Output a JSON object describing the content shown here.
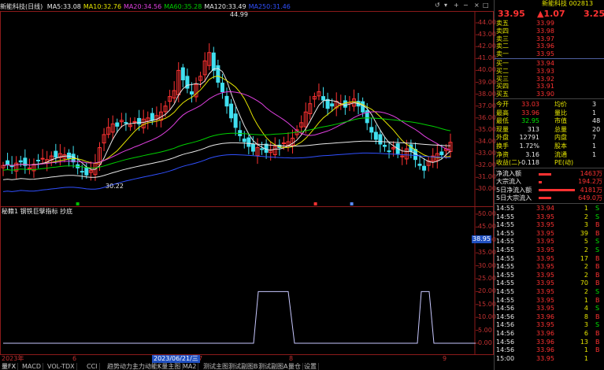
{
  "app": {
    "stock_label": "新能科技(日线)",
    "stock_name": "新能科技",
    "stock_code": "002813"
  },
  "ma_legend": [
    {
      "label": "MA5:",
      "value": "33.08",
      "color": "#e8e8e8"
    },
    {
      "label": "MA10:",
      "value": "32.76",
      "color": "#e6e600"
    },
    {
      "label": "MA20:",
      "value": "34.56",
      "color": "#e040e0"
    },
    {
      "label": "MA60:",
      "value": "35.28",
      "color": "#00d000"
    },
    {
      "label": "MA120:",
      "value": "33.49",
      "color": "#e8e8e8"
    },
    {
      "label": "MA250:",
      "value": "31.46",
      "color": "#3050ff"
    }
  ],
  "top_right": {
    "price": "33.95",
    "change": "▲1.07",
    "change_pct": "3.25"
  },
  "annotations": {
    "high": "44.99",
    "low": "30.22"
  },
  "price_axis": [
    "44.00",
    "43.00",
    "42.00",
    "41.00",
    "40.00",
    "39.00",
    "38.00",
    "37.00",
    "36.00",
    "35.00",
    "34.00",
    "33.00",
    "32.00",
    "31.00",
    "30.00"
  ],
  "indicator": {
    "title": "秘籍1 钢铁巨擘指标 抄底",
    "axis": [
      "50.00",
      "45.00",
      "40.00",
      "35.00",
      "30.00",
      "25.00",
      "20.00",
      "15.00",
      "10.00",
      "5.00",
      "0.00"
    ],
    "current": "38.95",
    "chart_data": {
      "type": "line",
      "x": [
        0,
        1,
        2,
        3,
        4,
        5,
        6,
        7,
        8,
        9,
        10,
        11,
        12,
        13,
        14
      ],
      "y": [
        0,
        0,
        0,
        0,
        0,
        0,
        20,
        20,
        0,
        0,
        0,
        0,
        20,
        0,
        0
      ],
      "ylim": [
        0,
        50
      ]
    }
  },
  "time_axis": {
    "labels": [
      "2023年",
      "6",
      "7",
      "8",
      "9"
    ],
    "highlight": "2023/06/21/三"
  },
  "bottom_tabs": [
    "量FX",
    "MACD",
    "VOL-TDX",
    "CCI",
    "趋势动力",
    "主力动能",
    "K量主图",
    "MA2",
    "测试主图",
    "测试副图B",
    "测试副图A",
    "量仓",
    "设置"
  ],
  "order_book": {
    "sell": [
      {
        "label": "卖五",
        "price": "33.99"
      },
      {
        "label": "卖四",
        "price": "33.98"
      },
      {
        "label": "卖三",
        "price": "33.97"
      },
      {
        "label": "卖二",
        "price": "33.96"
      },
      {
        "label": "卖一",
        "price": "33.95"
      }
    ],
    "buy": [
      {
        "label": "买一",
        "price": "33.94"
      },
      {
        "label": "买二",
        "price": "33.93"
      },
      {
        "label": "买三",
        "price": "33.92"
      },
      {
        "label": "买四",
        "price": "33.91"
      },
      {
        "label": "买五",
        "price": "33.90"
      }
    ]
  },
  "quote": [
    {
      "l1": "今开",
      "v1": "33.03",
      "l2": "均价",
      "v2": "3"
    },
    {
      "l1": "最高",
      "v1": "33.96",
      "l2": "量比",
      "v2": "1"
    },
    {
      "l1": "最低",
      "v1": "32.95",
      "l2": "市值",
      "v2": "48"
    },
    {
      "l1": "现量",
      "v1": "313",
      "l2": "总量",
      "v2": "20"
    },
    {
      "l1": "外盘",
      "v1": "12791",
      "l2": "内盘",
      "v2": "7"
    },
    {
      "l1": "换手",
      "v1": "1.72%",
      "l2": "股本",
      "v2": "1"
    },
    {
      "l1": "净资",
      "v1": "3.16",
      "l2": "流通",
      "v2": "1"
    },
    {
      "l1": "收益(二)",
      "v1": "-0.118",
      "l2": "PE(动)",
      "v2": ""
    }
  ],
  "fund_flow": [
    {
      "label": "净流入额",
      "value": "1463万",
      "bar": 0.3
    },
    {
      "label": "大宗流入",
      "value": "194.2万",
      "bar": 0.08
    },
    {
      "label": "5日净流入额",
      "value": "4181万",
      "bar": 0.85
    },
    {
      "label": "5日大宗流入",
      "value": "649.0万",
      "bar": 0.3
    }
  ],
  "ticks": [
    {
      "time": "14:55",
      "price": "33.94",
      "vol": "1",
      "side": "S"
    },
    {
      "time": "14:55",
      "price": "33.95",
      "vol": "2",
      "side": "S"
    },
    {
      "time": "14:55",
      "price": "33.95",
      "vol": "3",
      "side": "B"
    },
    {
      "time": "14:55",
      "price": "33.95",
      "vol": "39",
      "side": "B"
    },
    {
      "time": "14:55",
      "price": "33.95",
      "vol": "5",
      "side": "S"
    },
    {
      "time": "14:55",
      "price": "33.95",
      "vol": "2",
      "side": "S"
    },
    {
      "time": "14:55",
      "price": "33.95",
      "vol": "17",
      "side": "B"
    },
    {
      "time": "14:55",
      "price": "33.95",
      "vol": "2",
      "side": "B"
    },
    {
      "time": "14:55",
      "price": "33.95",
      "vol": "2",
      "side": "B"
    },
    {
      "time": "14:55",
      "price": "33.95",
      "vol": "70",
      "side": "B"
    },
    {
      "time": "14:55",
      "price": "33.95",
      "vol": "2",
      "side": "S"
    },
    {
      "time": "14:55",
      "price": "33.95",
      "vol": "1",
      "side": "B"
    },
    {
      "time": "14:56",
      "price": "33.95",
      "vol": "4",
      "side": "S"
    },
    {
      "time": "14:56",
      "price": "33.96",
      "vol": "8",
      "side": "B"
    },
    {
      "time": "14:56",
      "price": "33.95",
      "vol": "3",
      "side": "S"
    },
    {
      "time": "14:56",
      "price": "33.96",
      "vol": "6",
      "side": "B"
    },
    {
      "time": "14:56",
      "price": "33.96",
      "vol": "13",
      "side": "B"
    },
    {
      "time": "14:56",
      "price": "33.96",
      "vol": "1",
      "side": "B"
    },
    {
      "time": "15:00",
      "price": "33.95",
      "vol": "1"
    }
  ]
}
